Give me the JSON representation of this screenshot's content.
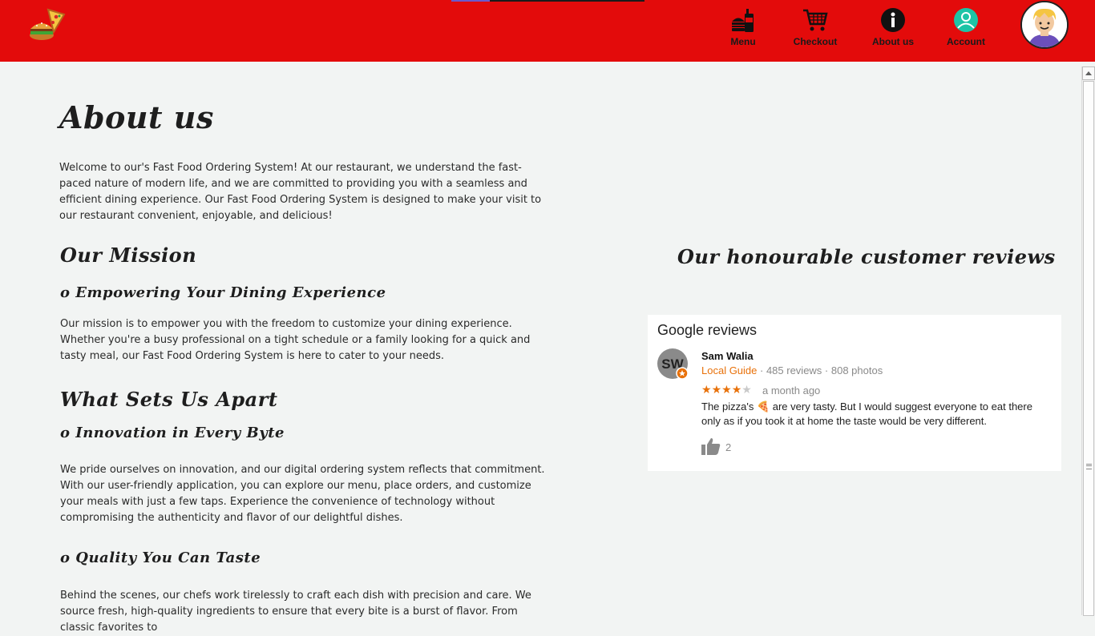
{
  "nav": {
    "items": [
      {
        "label": "Menu",
        "icon": "burger-drink-icon"
      },
      {
        "label": "Checkout",
        "icon": "cart-icon"
      },
      {
        "label": "About us",
        "icon": "info-icon"
      },
      {
        "label": "Account",
        "icon": "account-icon"
      }
    ],
    "brand_color": "#e30b0b"
  },
  "about": {
    "title": "About us",
    "intro": "Welcome to our's Fast Food Ordering System! At our restaurant, we understand the fast-paced nature of modern life, and we are committed to providing you with a seamless and efficient dining experience. Our Fast Food Ordering System is designed to make your visit to our restaurant convenient, enjoyable, and delicious!",
    "mission_heading": "Our Mission",
    "mission_sub": "o Empowering Your Dining Experience",
    "mission_text": "Our mission is to empower you with the freedom to customize your dining experience. Whether you're a busy professional on a tight schedule or a family looking for a quick and tasty meal, our Fast Food Ordering System is here to cater to your needs.",
    "apart_heading": "What Sets Us Apart",
    "apart_sub1": "o Innovation in Every Byte",
    "apart_text1": "We pride ourselves on innovation, and our digital ordering system reflects that commitment. With our user-friendly application, you can explore our menu, place orders, and customize your meals with just a few taps. Experience the convenience of technology without compromising the authenticity and flavor of our delightful dishes.",
    "apart_sub2": "o Quality You Can Taste",
    "apart_text2": "Behind the scenes, our chefs work tirelessly to craft each dish with precision and care. We source fresh, high-quality ingredients to ensure that every bite is a burst of flavor. From classic favorites to"
  },
  "reviews": {
    "title": "Our honourable customer reviews",
    "card_header": "Google reviews",
    "reviewer": {
      "initials": "SW",
      "name": "Sam Walia",
      "badge": "Local Guide",
      "stats": " · 485 reviews · 808 photos"
    },
    "rating": 4,
    "max_rating": 5,
    "when": "a month ago",
    "text": "The pizza's 🍕 are very tasty. But I would suggest everyone to eat there only as if you took it at home the taste would be very different.",
    "likes": "2",
    "accent_color": "#e8710a"
  }
}
